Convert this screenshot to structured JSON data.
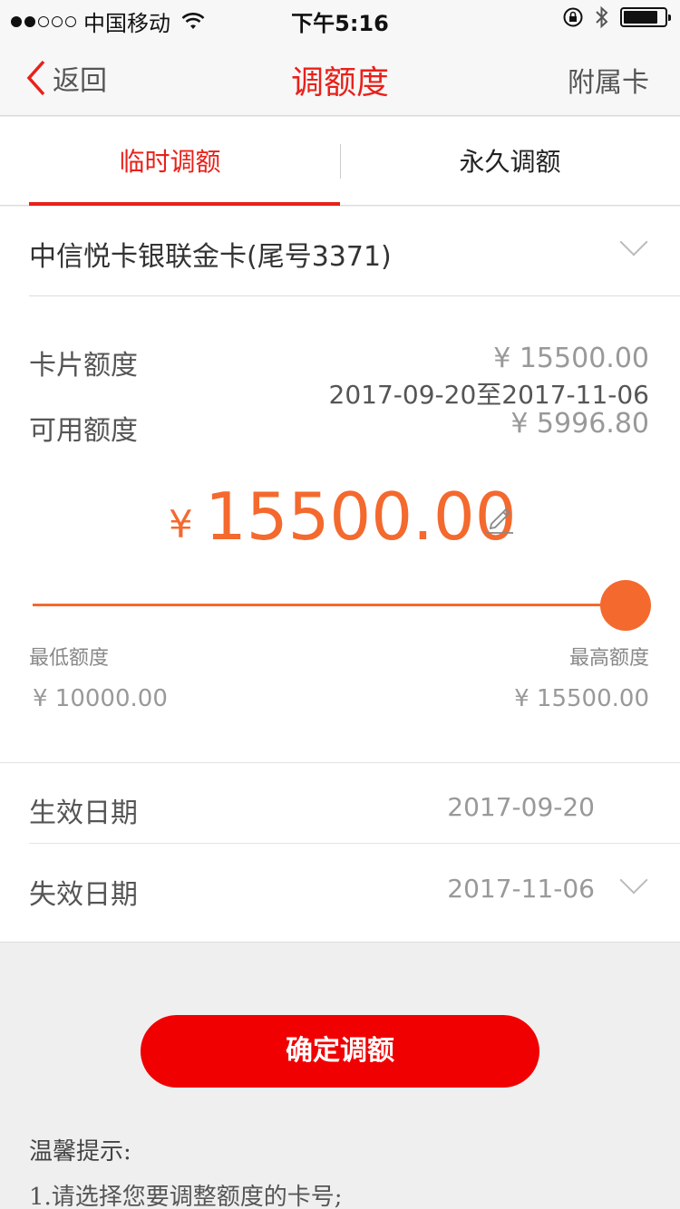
{
  "status_bar": {
    "carrier": "中国移动",
    "time": "下午5:16",
    "icons": [
      "wifi-icon",
      "rotation-lock-icon",
      "bluetooth-icon",
      "battery-icon"
    ]
  },
  "nav": {
    "back_label": "返回",
    "title": "调额度",
    "right_label": "附属卡"
  },
  "tabs": [
    {
      "label": "临时调额",
      "active": true
    },
    {
      "label": "永久调额",
      "active": false
    }
  ],
  "card": {
    "name": "中信悦卡银联金卡(尾号3371)"
  },
  "info": {
    "card_limit_label": "卡片额度",
    "card_limit_value": "¥  15500.00",
    "period": "2017-09-20至2017-11-06",
    "available_label": "可用额度",
    "available_value": "¥  5996.80"
  },
  "amount": {
    "currency": "¥",
    "value": "15500.00"
  },
  "slider": {
    "level": 1.0,
    "min_label": "最低额度",
    "max_label": "最高额度",
    "min_value": "¥  10000.00",
    "max_value": "¥  15500.00"
  },
  "dates": {
    "effective_label": "生效日期",
    "effective_value": "2017-09-20",
    "expire_label": "失效日期",
    "expire_value": "2017-11-06"
  },
  "actions": {
    "confirm_label": "确定调额"
  },
  "tips": {
    "title": "温馨提示:",
    "lines": [
      "1.请选择您要调整额度的卡号;"
    ]
  },
  "colors": {
    "brand_red": "#e8211a",
    "accent_orange": "#f4692e",
    "button_red": "#f00000"
  }
}
